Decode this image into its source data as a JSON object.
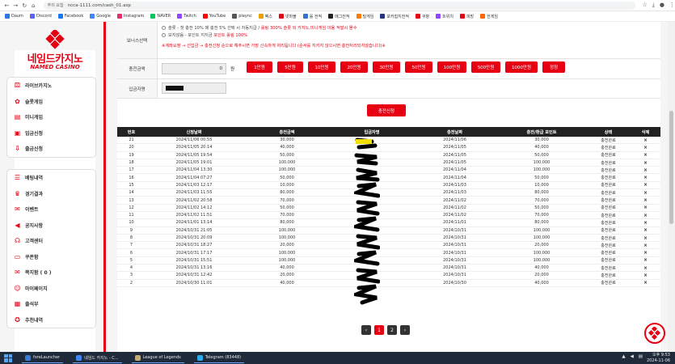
{
  "browser": {
    "url_badge": "주의 요함",
    "url": "ncca-1111.com/cash_01.asp",
    "bookmarks": [
      "Daum",
      "Discord",
      "Facebook",
      "Google",
      "Instagram",
      "NAVER",
      "Twitch",
      "YouTube",
      "plaync",
      "벡스",
      "넷마블",
      "롤 전적",
      "메그전적",
      "밀게임",
      "포커칩지전적",
      "쿠팡",
      "트위치",
      "피망",
      "한게임"
    ]
  },
  "logo": {
    "main": "네임드카지노",
    "sub": "NAMED CASINO"
  },
  "sidebar": {
    "group1": [
      {
        "label": "라이브카지노",
        "icon": "dice-icon"
      },
      {
        "label": "슬롯게임",
        "icon": "slot-icon"
      },
      {
        "label": "미니게임",
        "icon": "cards-icon"
      },
      {
        "label": "입금신청",
        "icon": "deposit-icon"
      },
      {
        "label": "출금신청",
        "icon": "withdraw-icon"
      }
    ],
    "group2": [
      {
        "label": "배팅내역",
        "icon": "list-icon"
      },
      {
        "label": "경기결과",
        "icon": "trophy-icon"
      },
      {
        "label": "이벤트",
        "icon": "gift-icon"
      },
      {
        "label": "공지사항",
        "icon": "megaphone-icon"
      },
      {
        "label": "고객센터",
        "icon": "headset-icon"
      },
      {
        "label": "쿠폰함",
        "icon": "coupon-icon"
      },
      {
        "label": "쪽지함 ( 0 )",
        "icon": "mail-icon"
      },
      {
        "label": "마이페이지",
        "icon": "user-icon"
      },
      {
        "label": "출석부",
        "icon": "calendar-icon"
      },
      {
        "label": "추천내역",
        "icon": "recommend-icon"
      }
    ]
  },
  "form": {
    "bonus_label": "보너스선택",
    "bonus_opt1": "슬롯 - 첫 충전 10% 매 충전 5% 선택 시 자동지급 /",
    "bonus_opt1_red": "롤링 300% 슬롯 외 카지노,미니게임 이용 적발시 몰수",
    "bonus_opt2": "보지않음 - 포인트 지지금",
    "bonus_opt2_red": "포인트 롤링 100%",
    "notice": "※계좌요청 → 선입금 → 충전신청 순으로 해주시면 가장 신속하게 처리됩니다 (순서를 지키지 않으시면 충전처리되지않습니다)※",
    "amount_label": "충전금액",
    "amount_value": "0",
    "won": "원",
    "amount_buttons": [
      "1만원",
      "5만원",
      "10만원",
      "20만원",
      "30만원",
      "50만원",
      "100만원",
      "500만원",
      "1000만원",
      "정정"
    ],
    "depositor_label": "입금자명",
    "submit": "충전신청"
  },
  "table": {
    "headers": [
      "번호",
      "신청날짜",
      "충전금액",
      "입금자명",
      "충전날짜",
      "충전/환급 포인트",
      "상태",
      "삭제"
    ],
    "rows": [
      {
        "no": "21",
        "req": "2024/11/06 00:55",
        "amt": "30,000",
        "date": "2024/11/06",
        "pts": "30,000",
        "status": "충전완료"
      },
      {
        "no": "20",
        "req": "2024/11/05 20:14",
        "amt": "40,000",
        "date": "2024/11/05",
        "pts": "40,000",
        "status": "충전완료"
      },
      {
        "no": "19",
        "req": "2024/11/05 19:54",
        "amt": "50,000",
        "date": "2024/11/05",
        "pts": "50,000",
        "status": "충전완료"
      },
      {
        "no": "18",
        "req": "2024/11/05 19:01",
        "amt": "100,000",
        "date": "2024/11/05",
        "pts": "100,000",
        "status": "충전완료"
      },
      {
        "no": "17",
        "req": "2024/11/04 13:30",
        "amt": "100,000",
        "date": "2024/11/04",
        "pts": "100,000",
        "status": "충전완료"
      },
      {
        "no": "16",
        "req": "2024/11/04 07:27",
        "amt": "50,000",
        "date": "2024/11/04",
        "pts": "50,000",
        "status": "충전완료"
      },
      {
        "no": "15",
        "req": "2024/11/03 12:17",
        "amt": "10,000",
        "date": "2024/11/03",
        "pts": "10,000",
        "status": "충전완료"
      },
      {
        "no": "14",
        "req": "2024/11/03 11:55",
        "amt": "80,000",
        "date": "2024/11/03",
        "pts": "80,000",
        "status": "충전완료"
      },
      {
        "no": "13",
        "req": "2024/11/02 20:58",
        "amt": "70,000",
        "date": "2024/11/02",
        "pts": "70,000",
        "status": "충전완료"
      },
      {
        "no": "12",
        "req": "2024/11/02 14:12",
        "amt": "50,000",
        "date": "2024/11/02",
        "pts": "50,000",
        "status": "충전완료"
      },
      {
        "no": "11",
        "req": "2024/11/02 11:51",
        "amt": "70,000",
        "date": "2024/11/02",
        "pts": "70,000",
        "status": "충전완료"
      },
      {
        "no": "10",
        "req": "2024/11/01 13:14",
        "amt": "80,000",
        "date": "2024/11/01",
        "pts": "80,000",
        "status": "충전완료"
      },
      {
        "no": "9",
        "req": "2024/10/31 21:05",
        "amt": "100,000",
        "date": "2024/10/31",
        "pts": "100,000",
        "status": "충전완료"
      },
      {
        "no": "8",
        "req": "2024/10/31 20:09",
        "amt": "100,000",
        "date": "2024/10/31",
        "pts": "100,000",
        "status": "충전완료"
      },
      {
        "no": "7",
        "req": "2024/10/31 18:27",
        "amt": "20,000",
        "date": "2024/10/31",
        "pts": "20,000",
        "status": "충전완료"
      },
      {
        "no": "6",
        "req": "2024/10/31 17:17",
        "amt": "100,000",
        "date": "2024/10/31",
        "pts": "100,000",
        "status": "충전완료"
      },
      {
        "no": "5",
        "req": "2024/10/31 15:51",
        "amt": "100,000",
        "date": "2024/10/31",
        "pts": "100,000",
        "status": "충전완료"
      },
      {
        "no": "4",
        "req": "2024/10/31 13:16",
        "amt": "40,000",
        "date": "2024/10/31",
        "pts": "40,000",
        "status": "충전완료"
      },
      {
        "no": "3",
        "req": "2024/10/31 12:42",
        "amt": "20,000",
        "date": "2024/10/31",
        "pts": "20,000",
        "status": "충전완료"
      },
      {
        "no": "2",
        "req": "2024/10/30 11:01",
        "amt": "40,000",
        "date": "2024/10/30",
        "pts": "40,000",
        "status": "충전완료"
      }
    ],
    "delete_mark": "×"
  },
  "pager": {
    "prev": "‹",
    "pages": [
      "1",
      "2"
    ],
    "next": "›"
  },
  "taskbar": {
    "items": [
      "foreLauncher",
      "네임드 카지노 - C...",
      "League of Legends",
      "Telegram (83448)"
    ],
    "time": "오후 9:53",
    "date": "2024-11-06"
  },
  "colors": {
    "accent": "#e60012",
    "header": "#222222"
  }
}
